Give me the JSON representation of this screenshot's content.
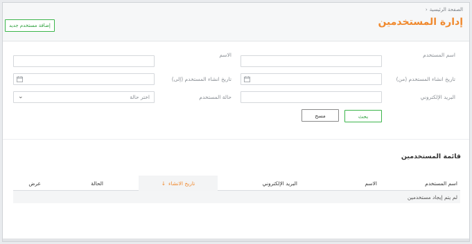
{
  "header": {
    "breadcrumb": "الصفحة الرئيسية",
    "title": "إدارة المستخدمين",
    "add_button": "إضافة مستخدم جديد"
  },
  "search": {
    "username_label": "اسم المستخدم",
    "name_label": "الاسم",
    "created_from_label": "تاريخ انشاء المستخدم (من)",
    "created_to_label": "تاريخ انشاء المستخدم (إلى)",
    "email_label": "البريد الإلكتروني",
    "status_label": "حالة المستخدم",
    "status_placeholder": "اختر حالة",
    "search_button": "بحث",
    "clear_button": "مسح"
  },
  "list": {
    "title": "قائمة المستخدمين",
    "columns": [
      "اسم المستخدم",
      "الاسم",
      "البريد الإلكتروني",
      "تاريخ الانشاء",
      "الحالة",
      "عرض"
    ],
    "empty_message": "لم يتم إيجاد مستخدمين"
  },
  "colors": {
    "accent": "#f0892e",
    "primary_button": "#3bb54a"
  }
}
